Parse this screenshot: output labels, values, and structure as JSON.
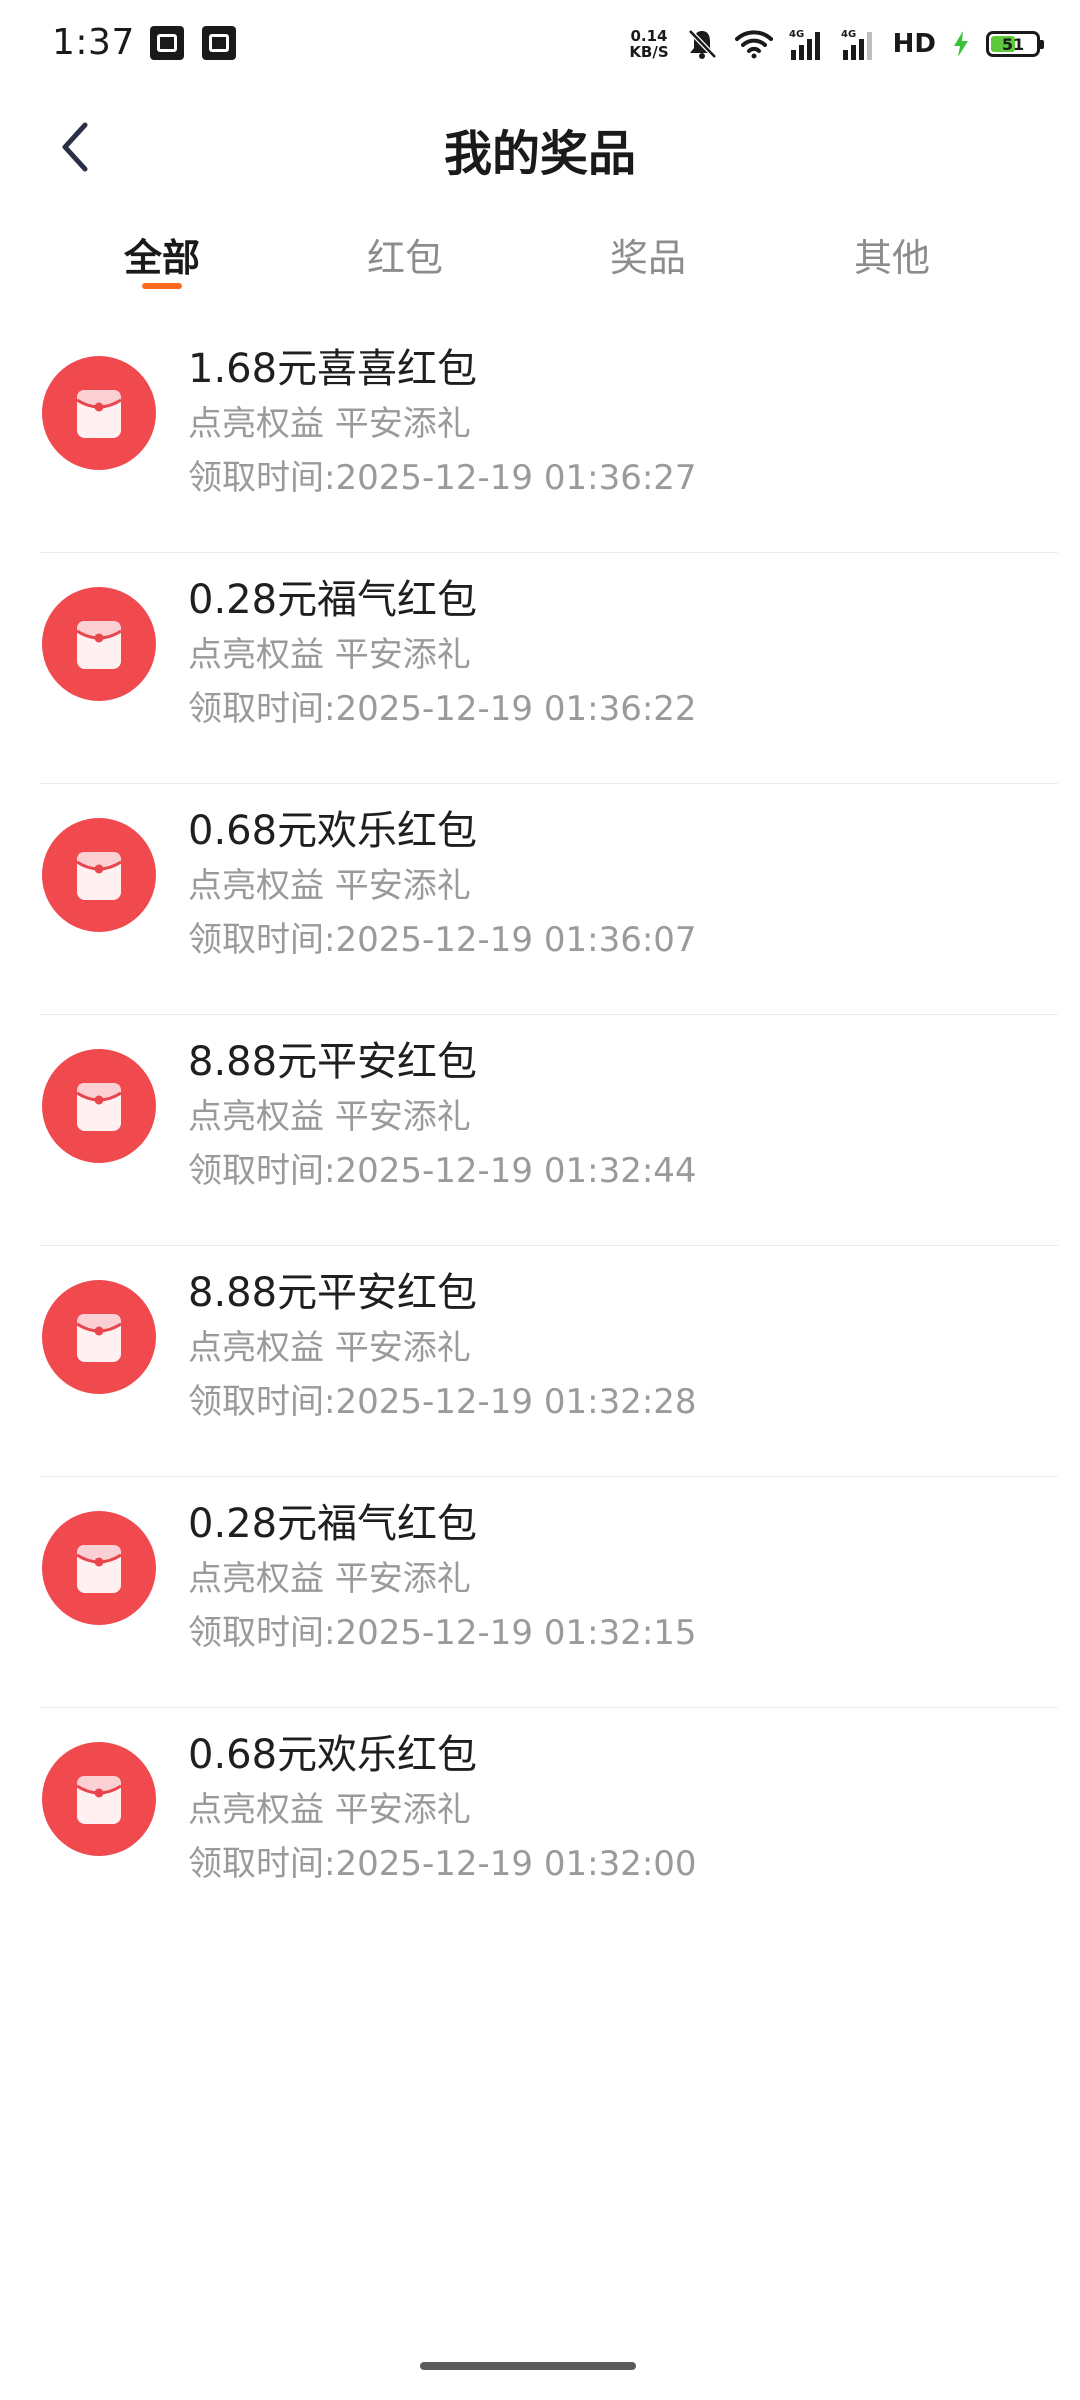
{
  "status_bar": {
    "time": "1:37",
    "net_speed_value": "0.14",
    "net_speed_unit": "KB/S",
    "hd_label": "HD",
    "battery_level": "51",
    "icons": [
      "app-notification-icon",
      "app-notification-icon",
      "mute-icon",
      "wifi-icon",
      "signal-4g-icon",
      "signal-4g-icon",
      "charging-icon",
      "battery-icon"
    ]
  },
  "header": {
    "title": "我的奖品",
    "back_icon": "chevron-left-icon"
  },
  "tabs": [
    {
      "label": "全部",
      "active": true
    },
    {
      "label": "红包",
      "active": false
    },
    {
      "label": "奖品",
      "active": false
    },
    {
      "label": "其他",
      "active": false
    }
  ],
  "colors": {
    "accent": "#ff6a1f",
    "redpack": "#f04a4f",
    "text_primary": "#1f1f1f",
    "text_secondary": "#9a9a9a"
  },
  "prizes": [
    {
      "title": "1.68元喜喜红包",
      "source": "点亮权益 平安添礼",
      "time": "领取时间:2025-12-19 01:36:27",
      "icon": "red-envelope-icon"
    },
    {
      "title": "0.28元福气红包",
      "source": "点亮权益 平安添礼",
      "time": "领取时间:2025-12-19 01:36:22",
      "icon": "red-envelope-icon"
    },
    {
      "title": "0.68元欢乐红包",
      "source": "点亮权益 平安添礼",
      "time": "领取时间:2025-12-19 01:36:07",
      "icon": "red-envelope-icon"
    },
    {
      "title": "8.88元平安红包",
      "source": "点亮权益 平安添礼",
      "time": "领取时间:2025-12-19 01:32:44",
      "icon": "red-envelope-icon"
    },
    {
      "title": "8.88元平安红包",
      "source": "点亮权益 平安添礼",
      "time": "领取时间:2025-12-19 01:32:28",
      "icon": "red-envelope-icon"
    },
    {
      "title": "0.28元福气红包",
      "source": "点亮权益 平安添礼",
      "time": "领取时间:2025-12-19 01:32:15",
      "icon": "red-envelope-icon"
    },
    {
      "title": "0.68元欢乐红包",
      "source": "点亮权益 平安添礼",
      "time": "领取时间:2025-12-19 01:32:00",
      "icon": "red-envelope-icon"
    }
  ]
}
